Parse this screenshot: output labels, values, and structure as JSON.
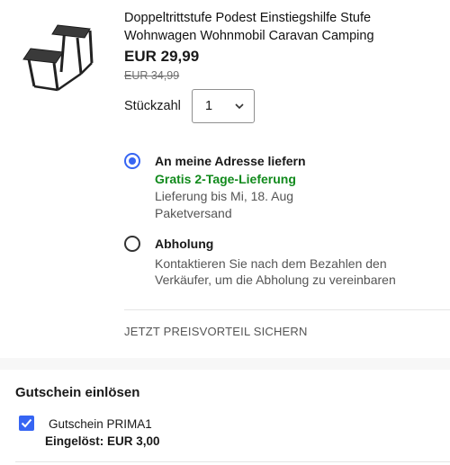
{
  "product": {
    "title": "Doppeltrittstufe Podest Einstiegshilfe Stufe Wohnwagen Wohnmobil Caravan Camping",
    "image_icon": "step-stool-icon",
    "price": "EUR 29,99",
    "old_price": "EUR 34,99"
  },
  "quantity": {
    "label": "Stückzahl",
    "value": "1",
    "icon": "chevron-down-icon"
  },
  "delivery": {
    "options": [
      {
        "title": "An meine Adresse liefern",
        "selected": true,
        "highlight": "Gratis 2-Tage-Lieferung",
        "lines": [
          "Lieferung bis Mi, 18. Aug",
          "Paketversand"
        ]
      },
      {
        "title": "Abholung",
        "selected": false,
        "lines": [
          "Kontaktieren Sie nach dem Bezahlen den",
          "Verkäufer, um die Abholung zu vereinbaren"
        ]
      }
    ],
    "promo_link": "JETZT PREISVORTEIL SICHERN"
  },
  "voucher": {
    "heading": "Gutschein einlösen",
    "checked": true,
    "name": "Gutschein PRIMA1",
    "redeemed": "Eingelöst: EUR 3,00"
  },
  "colors": {
    "accent_blue": "#3665f3",
    "success_green": "#118a1c",
    "muted_text": "#555555",
    "page_background": "#f7f7f7"
  }
}
